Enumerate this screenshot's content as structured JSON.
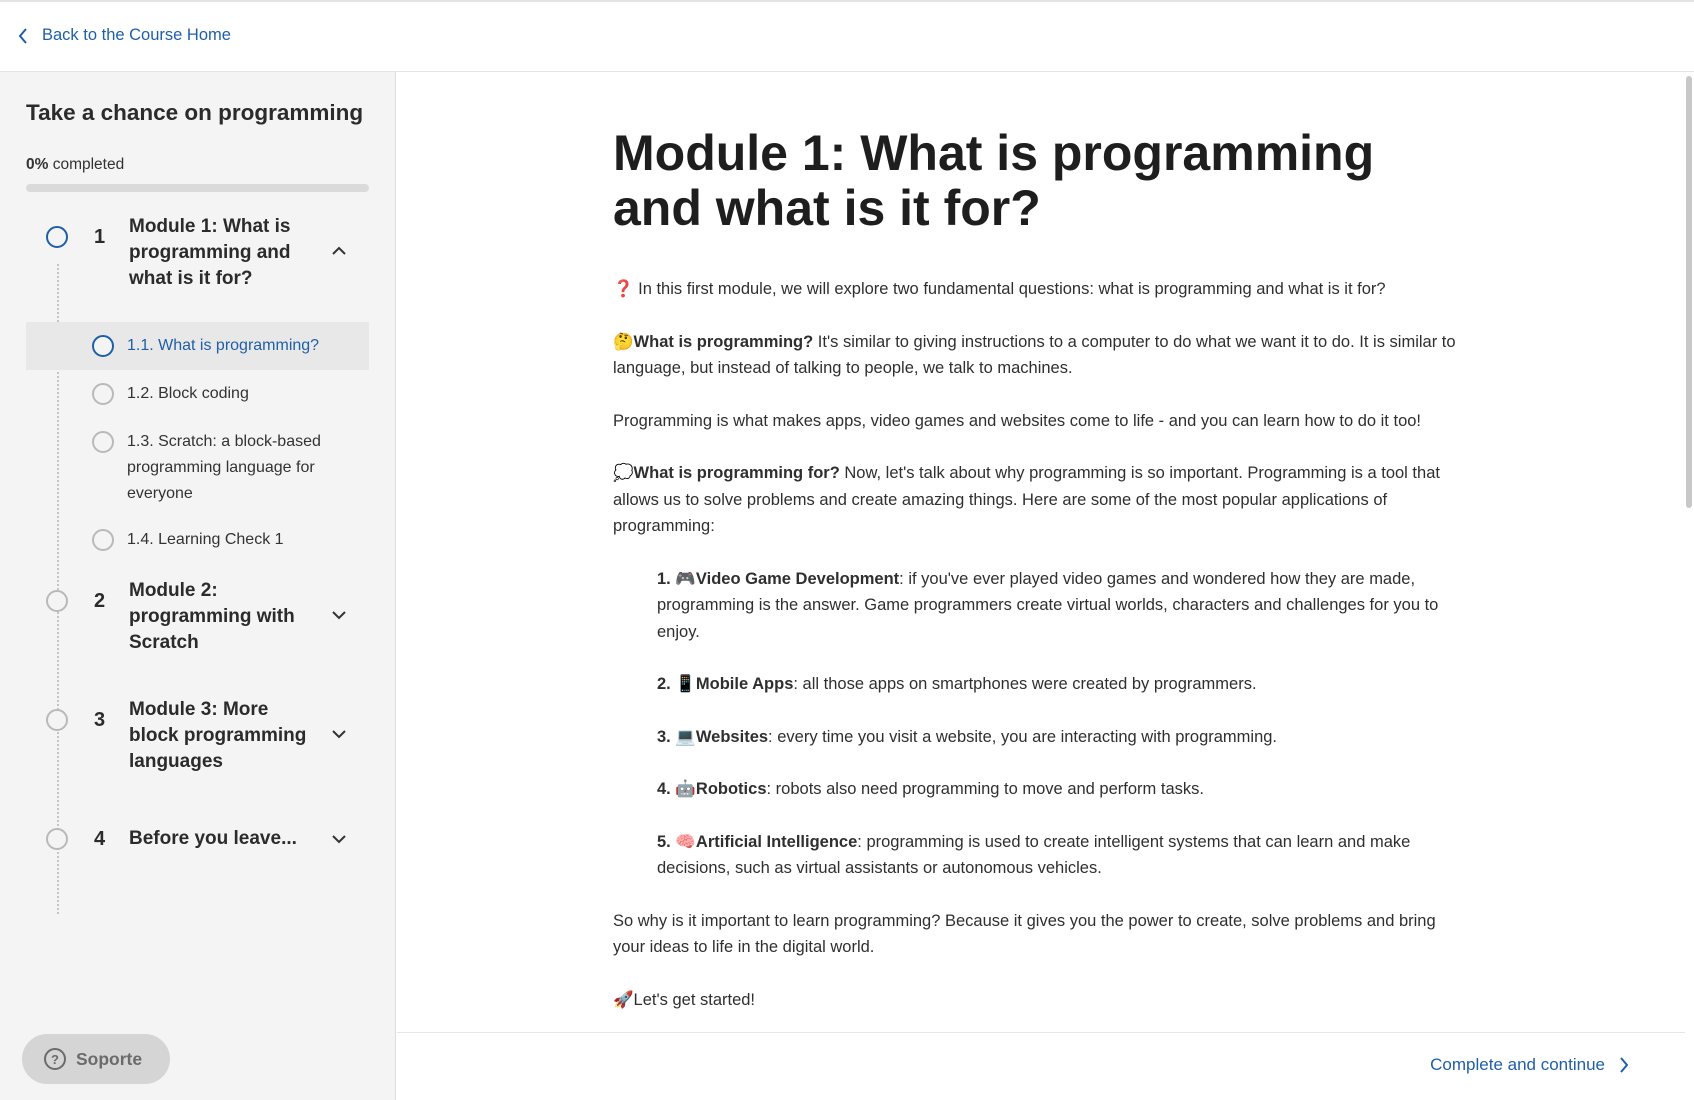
{
  "topbar": {
    "back_label": "Back to the Course Home"
  },
  "sidebar": {
    "course_title": "Take a chance on programming",
    "progress_percent": "0%",
    "progress_suffix": " completed",
    "progress_value": 0,
    "modules": [
      {
        "number": "1",
        "title": "Module 1: What is programming and what is it for?",
        "expanded": true
      },
      {
        "number": "2",
        "title": "Module 2: programming with Scratch",
        "expanded": false
      },
      {
        "number": "3",
        "title": "Module 3: More block programming languages",
        "expanded": false
      },
      {
        "number": "4",
        "title": "Before you leave...",
        "expanded": false
      }
    ],
    "lessons": [
      {
        "label": "1.1. What is programming?",
        "active": true
      },
      {
        "label": "1.2. Block coding",
        "active": false
      },
      {
        "label": "1.3. Scratch: a block-based programming language for everyone",
        "active": false
      },
      {
        "label": "1.4. Learning Check 1",
        "active": false
      }
    ],
    "support_label": "Soporte"
  },
  "main": {
    "title": "Module 1: What is programming and what is it for?",
    "intro": {
      "emoji": "❓",
      "text": " In this first module, we will explore two fundamental questions: what is programming and what is it for?"
    },
    "p1": {
      "emoji": "🤔",
      "bold": "What is programming?",
      "text": " It's similar to giving instructions to a computer to do what we want it to do. It is similar to language, but instead of talking to people, we talk to machines."
    },
    "p2": "Programming is what makes apps, video games and websites come to life - and you can learn how to do it too!",
    "p3": {
      "emoji": "💭",
      "bold": "What is programming for?",
      "text": " Now, let's talk about why programming is so important. Programming is a tool that allows us to solve problems and create amazing things. Here are some of the most popular applications of programming:"
    },
    "list": [
      {
        "num": "1. ",
        "emoji": "🎮",
        "bold": "Video Game Development",
        "text": ": if you've ever played video games and wondered how they are made, programming is the answer. Game programmers create virtual worlds, characters and challenges for you to enjoy."
      },
      {
        "num": "2. ",
        "emoji": "📱",
        "bold": "Mobile Apps",
        "text": ": all those apps on smartphones were created by programmers."
      },
      {
        "num": "3. ",
        "emoji": "💻",
        "bold": "Websites",
        "text": ": every time you visit a website, you are interacting with programming."
      },
      {
        "num": "4. ",
        "emoji": "🤖",
        "bold": "Robotics",
        "text": ": robots also need programming to move and perform tasks."
      },
      {
        "num": "5. ",
        "emoji": "🧠",
        "bold": "Artificial Intelligence",
        "text": ": programming is used to create intelligent systems that can learn and make decisions, such as virtual assistants or autonomous vehicles."
      }
    ],
    "p4": "So why is it important to learn programming? Because it gives you the power to create, solve problems and bring your ideas to life in the digital world.",
    "p5": {
      "emoji": "🚀",
      "text": "Let's get started!"
    },
    "complete_label": "Complete and continue"
  },
  "colors": {
    "accent": "#1f5fa8",
    "sidebar_bg": "#f4f4f4"
  },
  "icons": {
    "back": "chevron-left-icon",
    "complete": "chevron-right-icon",
    "support": "help-circle-icon"
  }
}
